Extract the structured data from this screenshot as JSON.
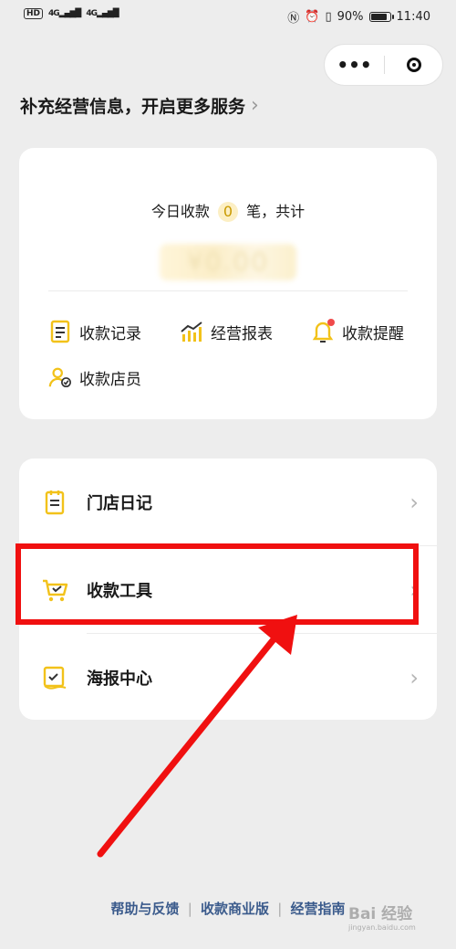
{
  "status_bar": {
    "network_badge": "HD",
    "sim1": "4G",
    "sim2": "4G",
    "battery_percent_text": "90%",
    "battery_level": 0.9,
    "time": "11:40"
  },
  "capsule": {
    "menu_icon": "more-dots-icon",
    "close_icon": "target-ring-icon"
  },
  "promo": {
    "text": "补充经营信息，开启更多服务",
    "chevron": "›"
  },
  "summary": {
    "prefix": "今日收款",
    "count": "0",
    "suffix": "笔，共计",
    "amount_blurred": "¥0.00"
  },
  "shortcuts": [
    {
      "label": "收款记录",
      "icon": "receipt-icon"
    },
    {
      "label": "经营报表",
      "icon": "chart-icon"
    },
    {
      "label": "收款提醒",
      "icon": "bell-icon",
      "badge": true
    },
    {
      "label": "收款店员",
      "icon": "staff-icon"
    }
  ],
  "menu": [
    {
      "label": "门店日记",
      "icon": "notebook-icon",
      "arrow": "›"
    },
    {
      "label": "收款工具",
      "icon": "cart-icon",
      "arrow": "›"
    },
    {
      "label": "海报中心",
      "icon": "poster-icon",
      "arrow": "›"
    }
  ],
  "footer": {
    "links": [
      "帮助与反馈",
      "收款商业版",
      "经营指南"
    ],
    "separator": "|"
  },
  "watermark": {
    "text": "Bai 经验",
    "sub": "jingyan.baidu.com"
  },
  "colors": {
    "accent_yellow": "#f2c21a",
    "highlight_red": "#f01010",
    "link_blue": "#3b5b8c"
  }
}
